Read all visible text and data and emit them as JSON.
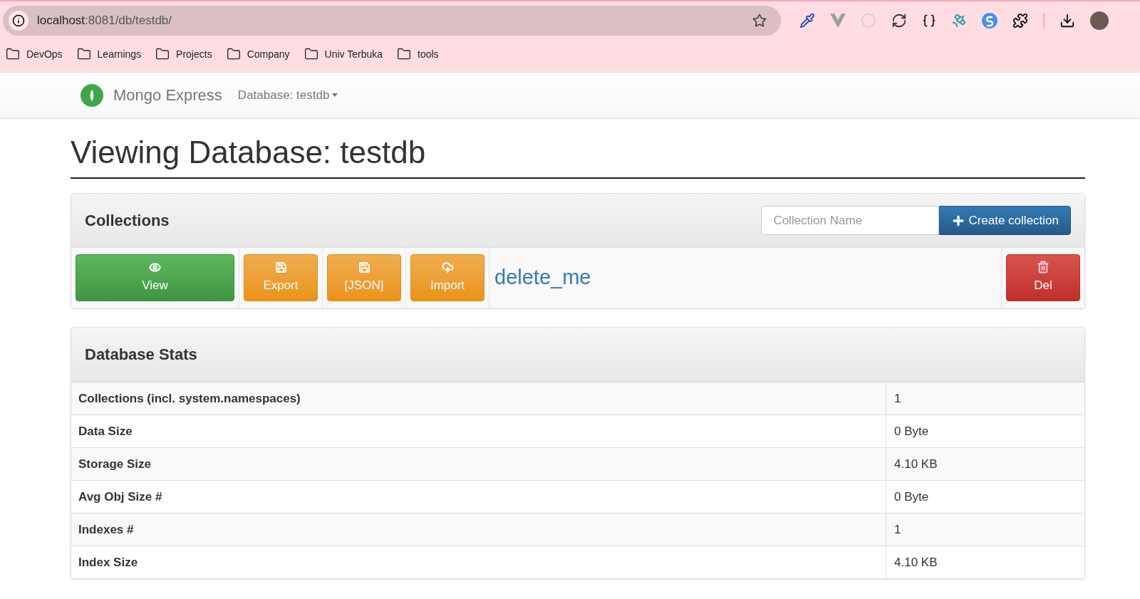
{
  "browser": {
    "url_host": "localhost",
    "url_path": ":8081/db/testdb/",
    "bookmarks": [
      "DevOps",
      "Learnings",
      "Projects",
      "Company",
      "Univ Terbuka",
      "tools"
    ]
  },
  "navbar": {
    "brand": "Mongo Express",
    "database_menu": "Database: testdb"
  },
  "heading": "Viewing Database: testdb",
  "collections": {
    "title": "Collections",
    "name_field": {
      "placeholder": "Collection Name"
    },
    "create_button": "Create collection",
    "rows": [
      {
        "actions": [
          {
            "kind": "view",
            "label": "View"
          },
          {
            "kind": "export",
            "label": "Export"
          },
          {
            "kind": "json",
            "label": "[JSON]"
          },
          {
            "kind": "import",
            "label": "Import"
          }
        ],
        "name": "delete_me",
        "delete_label": "Del"
      }
    ]
  },
  "stats": {
    "title": "Database Stats",
    "rows": [
      {
        "label": "Collections (incl. system.namespaces)",
        "value": "1"
      },
      {
        "label": "Data Size",
        "value": "0 Byte"
      },
      {
        "label": "Storage Size",
        "value": "4.10 KB"
      },
      {
        "label": "Avg Obj Size #",
        "value": "0 Byte"
      },
      {
        "label": "Indexes #",
        "value": "1"
      },
      {
        "label": "Index Size",
        "value": "4.10 KB"
      }
    ]
  }
}
